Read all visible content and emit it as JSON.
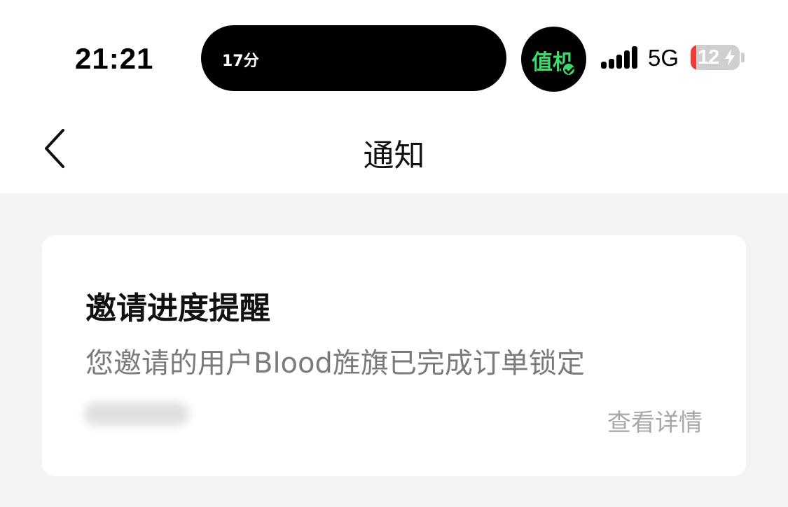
{
  "status_bar": {
    "time": "21:21",
    "island_text": "17分",
    "duty_badge": "值机",
    "network": "5G",
    "battery": {
      "level": 12,
      "label": "12",
      "charging": true
    },
    "colors": {
      "duty_green": "#3ddc6a",
      "battery_red": "#ef3a3a"
    }
  },
  "header": {
    "title": "通知",
    "back_icon": "chevron-left-icon"
  },
  "notification": {
    "title": "邀请进度提醒",
    "body": "您邀请的用户Blood旌旗已完成订单锁定",
    "action": "查看详情"
  }
}
